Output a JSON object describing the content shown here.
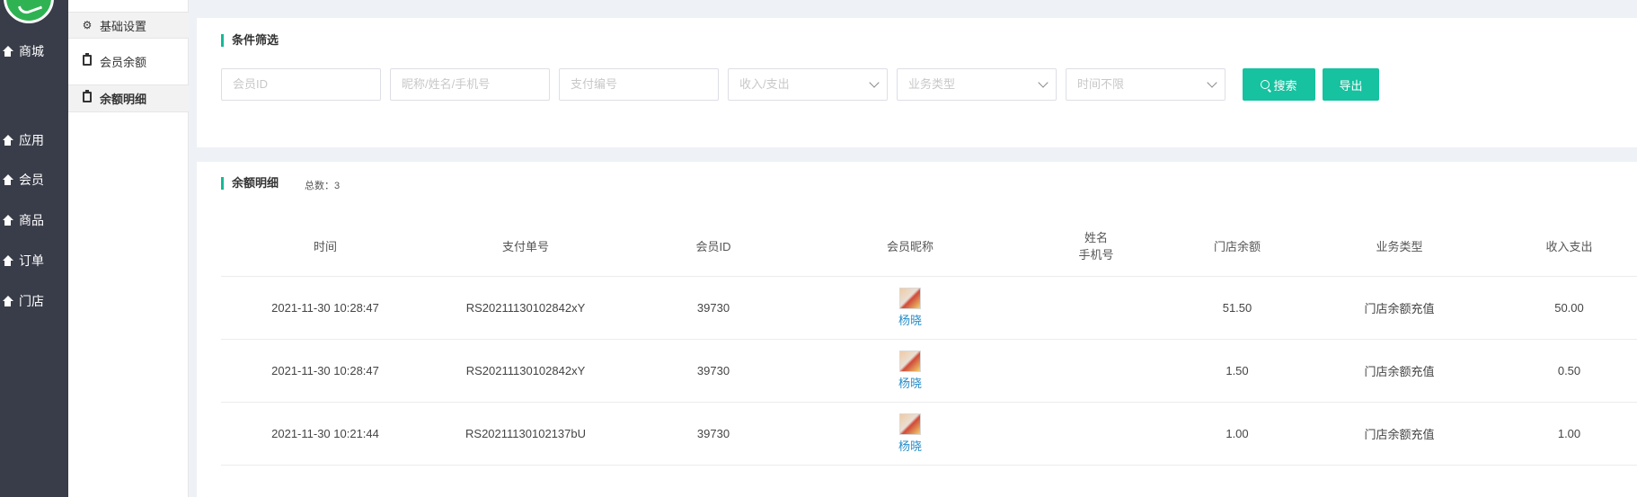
{
  "nav": {
    "items": [
      {
        "label": "商城",
        "icon": "home-icon"
      },
      {
        "label": "应用",
        "icon": "home-icon"
      },
      {
        "label": "会员",
        "icon": "home-icon"
      },
      {
        "label": "商品",
        "icon": "home-icon"
      },
      {
        "label": "订单",
        "icon": "home-icon"
      },
      {
        "label": "门店",
        "icon": "home-icon"
      }
    ]
  },
  "subnav": {
    "items": [
      {
        "label": "基础设置",
        "icon": "gear-icon"
      },
      {
        "label": "会员余额",
        "icon": "clipboard-icon"
      },
      {
        "label": "余额明细",
        "icon": "clipboard-icon"
      }
    ]
  },
  "filter": {
    "title": "条件筛选",
    "member_id_placeholder": "会员ID",
    "name_placeholder": "昵称/姓名/手机号",
    "pay_no_placeholder": "支付编号",
    "io_placeholder": "收入/支出",
    "biz_type_placeholder": "业务类型",
    "time_placeholder": "时间不限",
    "search_label": "搜索",
    "export_label": "导出"
  },
  "list": {
    "title": "余额明细",
    "count": "总数：3",
    "headers": {
      "time": "时间",
      "pay_no": "支付单号",
      "member_id": "会员ID",
      "nickname": "会员昵称",
      "name": "姓名",
      "phone": "手机号",
      "store_balance": "门店余额",
      "biz_type": "业务类型",
      "io": "收入支出"
    },
    "rows": [
      {
        "time": "2021-11-30 10:28:47",
        "pay_no": "RS20211130102842xY",
        "member_id": "39730",
        "nickname": "杨晓",
        "name": "",
        "store_balance": "51.50",
        "biz_type": "门店余额充值",
        "io": "50.00"
      },
      {
        "time": "2021-11-30 10:28:47",
        "pay_no": "RS20211130102842xY",
        "member_id": "39730",
        "nickname": "杨晓",
        "name": "",
        "store_balance": "1.50",
        "biz_type": "门店余额充值",
        "io": "0.50"
      },
      {
        "time": "2021-11-30 10:21:44",
        "pay_no": "RS20211130102137bU",
        "member_id": "39730",
        "nickname": "杨晓",
        "name": "",
        "store_balance": "1.00",
        "biz_type": "门店余额充值",
        "io": "1.00"
      }
    ]
  },
  "colors": {
    "accent": "#16c2a0",
    "sidebar": "#393d49",
    "link": "#2a8ec9"
  }
}
